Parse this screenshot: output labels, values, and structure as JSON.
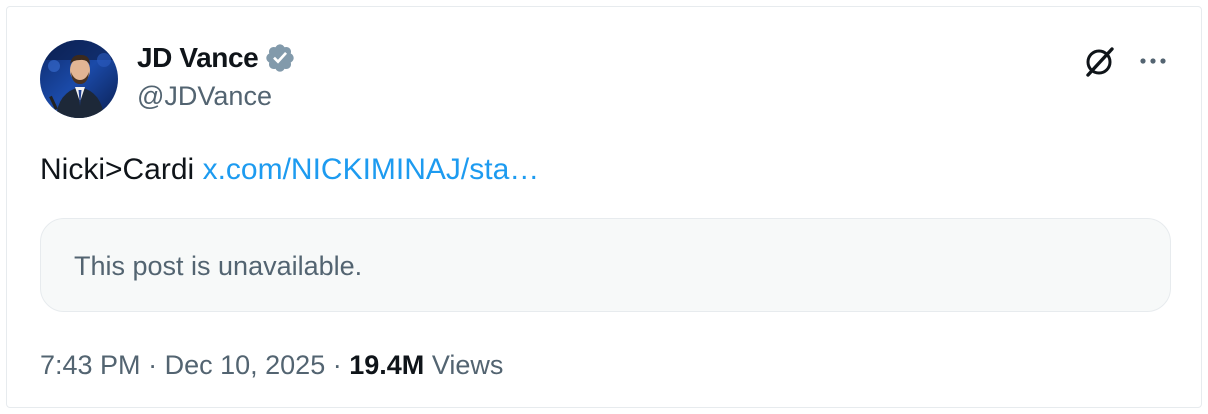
{
  "author": {
    "display_name": "JD Vance",
    "handle": "@JDVance",
    "verified": true,
    "verified_color": "#829aab"
  },
  "header_actions": {
    "grok_icon": "grok-icon",
    "more_icon": "more-horizontal-icon"
  },
  "tweet": {
    "text": "Nicki>Cardi",
    "link_text": "x.com/NICKIMINAJ/sta…",
    "link_color": "#1d9bf0"
  },
  "quoted_post": {
    "message": "This post is unavailable."
  },
  "meta": {
    "time": "7:43 PM",
    "separator": "·",
    "date": "Dec 10, 2025",
    "views_count": "19.4M",
    "views_label": "Views"
  }
}
